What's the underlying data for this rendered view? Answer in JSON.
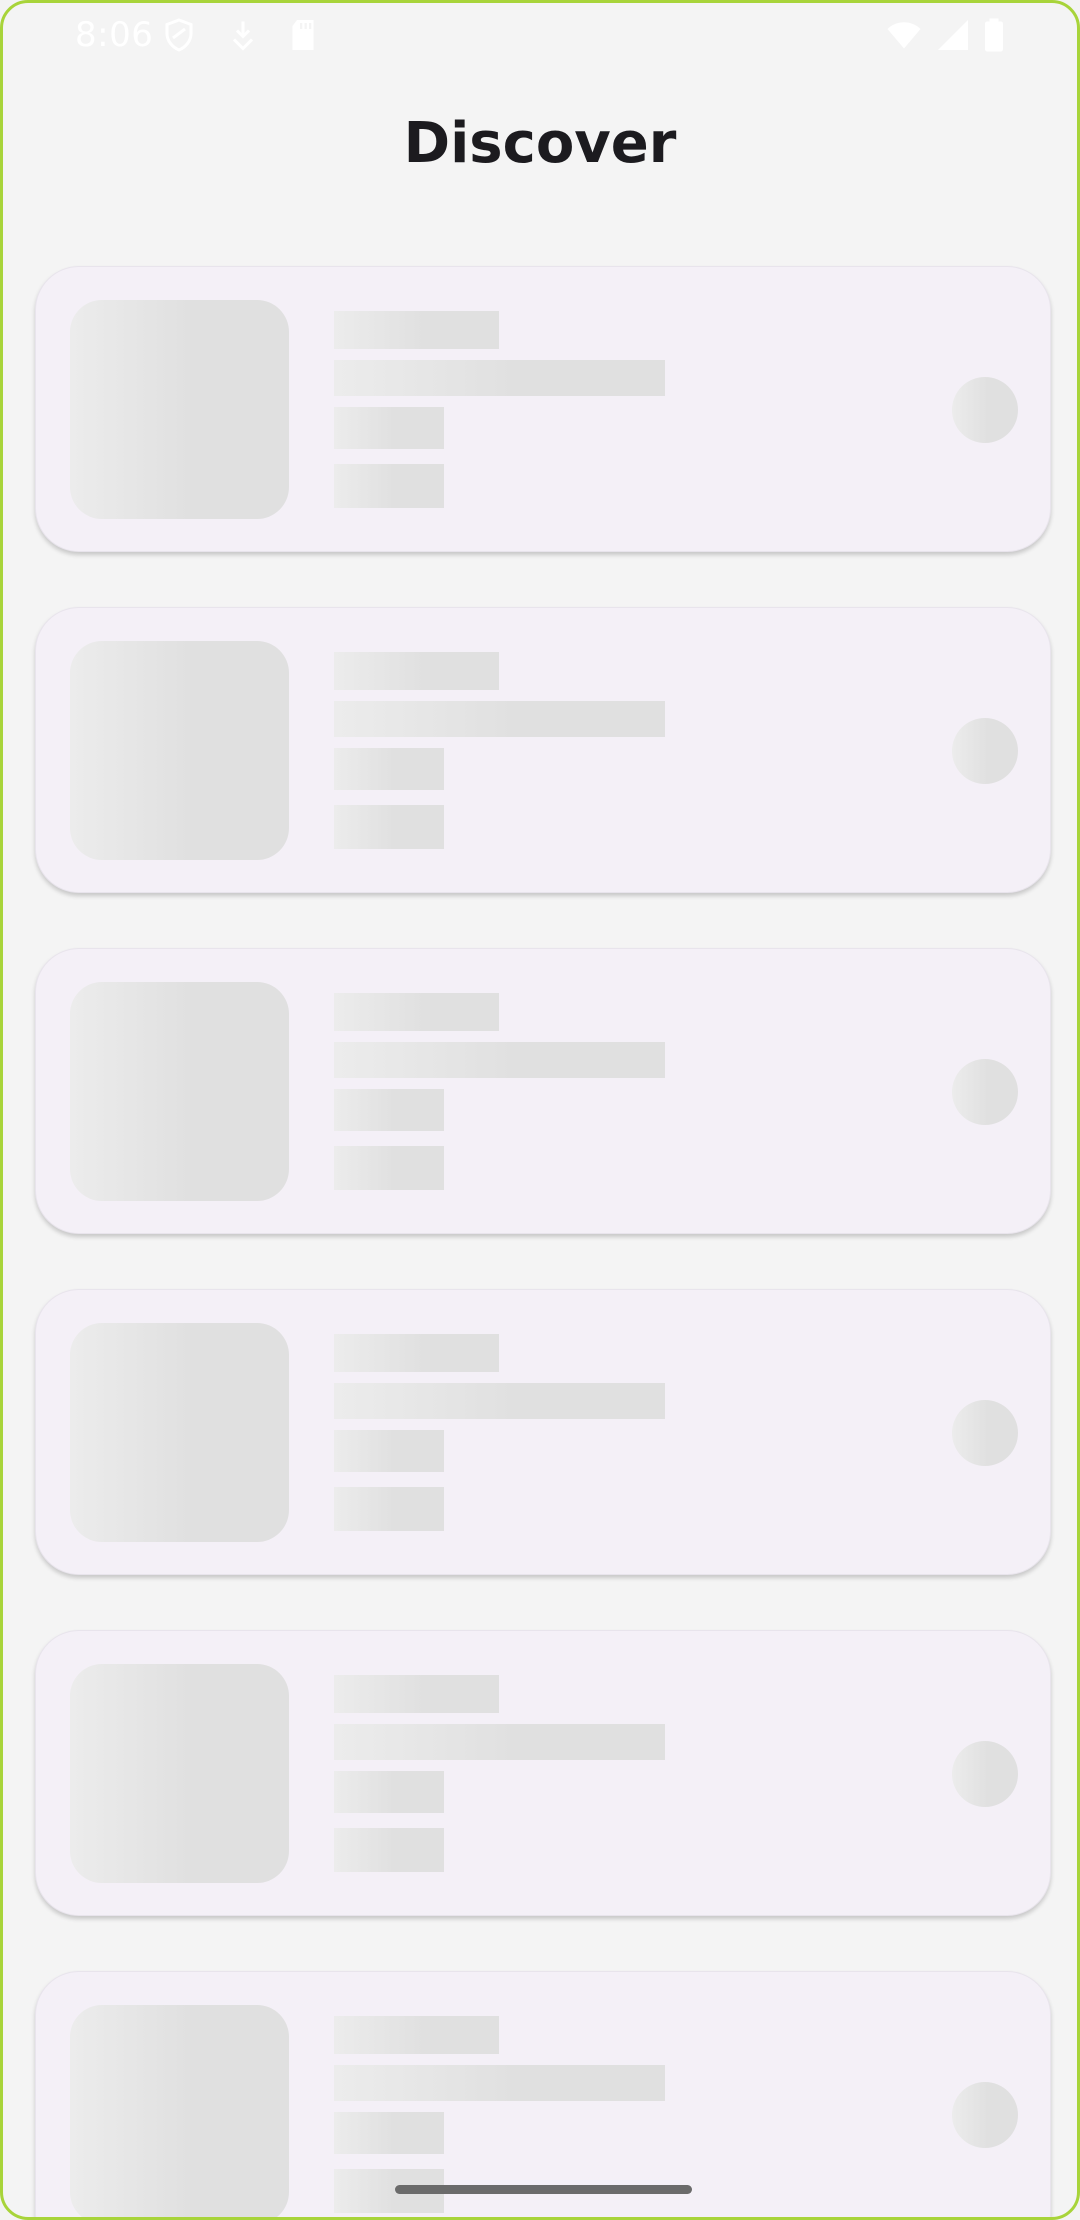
{
  "status_bar": {
    "time": "8:06",
    "icons": [
      "shield-icon",
      "download-icon",
      "sd-card-icon",
      "wifi-icon",
      "signal-icon",
      "battery-icon"
    ]
  },
  "header": {
    "title": "Discover"
  },
  "cards": [
    {
      "state": "loading-placeholder"
    },
    {
      "state": "loading-placeholder"
    },
    {
      "state": "loading-placeholder"
    },
    {
      "state": "loading-placeholder"
    },
    {
      "state": "loading-placeholder"
    },
    {
      "state": "loading-placeholder"
    }
  ],
  "colors": {
    "frame": "#a8d43a",
    "background": "#f4f4f4",
    "card": "#f4f0f7",
    "placeholder": "#e0e0e0",
    "title": "#1c1b1f"
  }
}
